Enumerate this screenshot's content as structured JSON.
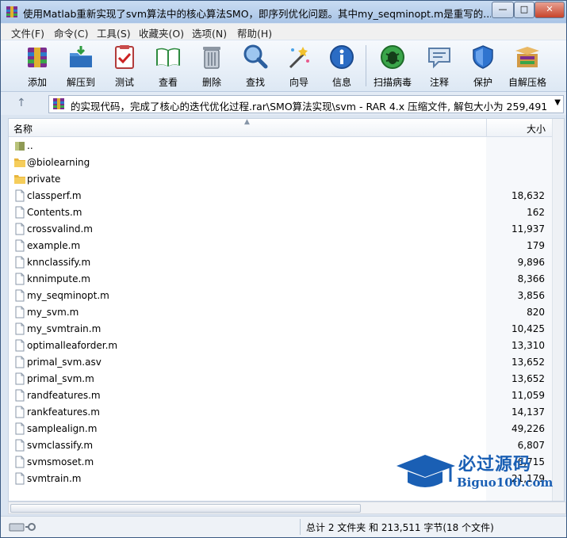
{
  "window": {
    "title": "使用Matlab重新实现了svm算法中的核心算法SMO，即序列优化问题。其中my_seqminopt.m是重写的...",
    "minimize": "—",
    "maximize": "□",
    "close": "✕"
  },
  "menu": [
    "文件(F)",
    "命令(C)",
    "工具(S)",
    "收藏夹(O)",
    "选项(N)",
    "帮助(H)"
  ],
  "toolbar": [
    {
      "label": "添加",
      "icon": "add-archive-icon"
    },
    {
      "label": "解压到",
      "icon": "extract-to-icon"
    },
    {
      "label": "测试",
      "icon": "test-icon"
    },
    {
      "label": "查看",
      "icon": "view-icon"
    },
    {
      "label": "删除",
      "icon": "delete-icon"
    },
    {
      "label": "查找",
      "icon": "find-icon"
    },
    {
      "label": "向导",
      "icon": "wizard-icon"
    },
    {
      "label": "信息",
      "icon": "info-icon"
    },
    {
      "label": "扫描病毒",
      "icon": "virus-scan-icon"
    },
    {
      "label": "注释",
      "icon": "comment-icon"
    },
    {
      "label": "保护",
      "icon": "protect-icon"
    },
    {
      "label": "自解压格",
      "icon": "sfx-icon"
    }
  ],
  "address": {
    "up": "↑",
    "path": "的实现代码，完成了核心的迭代优化过程.rar\\SMO算法实现\\svm - RAR 4.x 压缩文件, 解包大小为 259,491 字节",
    "dropdown": "▼"
  },
  "columns": {
    "name": "名称",
    "size": "大小",
    "sort": "▲"
  },
  "files": [
    {
      "name": "..",
      "size": "",
      "type": "folder"
    },
    {
      "name": "@biolearning",
      "size": "",
      "type": "folder"
    },
    {
      "name": "private",
      "size": "",
      "type": "folder"
    },
    {
      "name": "classperf.m",
      "size": "18,632",
      "type": "file"
    },
    {
      "name": "Contents.m",
      "size": "162",
      "type": "file"
    },
    {
      "name": "crossvalind.m",
      "size": "11,937",
      "type": "file"
    },
    {
      "name": "example.m",
      "size": "179",
      "type": "file"
    },
    {
      "name": "knnclassify.m",
      "size": "9,896",
      "type": "file"
    },
    {
      "name": "knnimpute.m",
      "size": "8,366",
      "type": "file"
    },
    {
      "name": "my_seqminopt.m",
      "size": "3,856",
      "type": "file"
    },
    {
      "name": "my_svm.m",
      "size": "820",
      "type": "file"
    },
    {
      "name": "my_svmtrain.m",
      "size": "10,425",
      "type": "file"
    },
    {
      "name": "optimalleaforder.m",
      "size": "13,310",
      "type": "file"
    },
    {
      "name": "primal_svm.asv",
      "size": "13,652",
      "type": "file"
    },
    {
      "name": "primal_svm.m",
      "size": "13,652",
      "type": "file"
    },
    {
      "name": "randfeatures.m",
      "size": "11,059",
      "type": "file"
    },
    {
      "name": "rankfeatures.m",
      "size": "14,137",
      "type": "file"
    },
    {
      "name": "samplealign.m",
      "size": "49,226",
      "type": "file"
    },
    {
      "name": "svmclassify.m",
      "size": "6,807",
      "type": "file"
    },
    {
      "name": "svmsmoset.m",
      "size": "6,715",
      "type": "file"
    },
    {
      "name": "svmtrain.m",
      "size": "21,179",
      "type": "file"
    }
  ],
  "status": {
    "summary": "总计 2 文件夹 和 213,511 字节(18 个文件)"
  },
  "watermark": {
    "cn": "必过源码",
    "en": "Biguo100.com"
  },
  "colors": {
    "accent": "#1a5fb4",
    "folder": "#e8b53c",
    "toolbar_bg": "#dde8f4"
  }
}
